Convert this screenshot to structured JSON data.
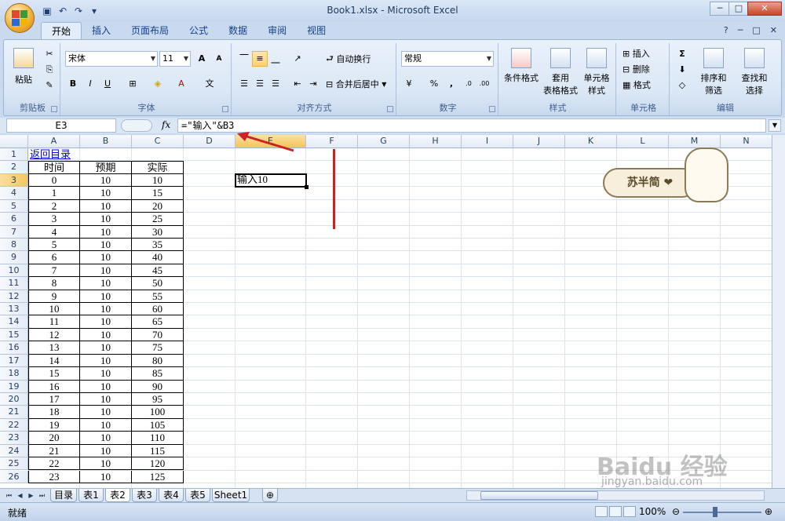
{
  "window": {
    "title": "Book1.xlsx - Microsoft Excel",
    "min": "─",
    "max": "□",
    "close": "✕"
  },
  "qat": {
    "save_icon": "save-icon",
    "undo_icon": "undo-icon",
    "redo_icon": "redo-icon"
  },
  "tabs": [
    "开始",
    "插入",
    "页面布局",
    "公式",
    "数据",
    "审阅",
    "视图"
  ],
  "ribbon": {
    "clipboard": {
      "label": "剪贴板",
      "paste": "粘贴"
    },
    "font": {
      "label": "字体",
      "font_name": "宋体",
      "font_size": "11"
    },
    "alignment": {
      "label": "对齐方式",
      "wrap": "自动换行",
      "merge": "合并后居中"
    },
    "number": {
      "label": "数字",
      "format": "常规",
      "percent": "%",
      "comma": ","
    },
    "styles": {
      "label": "样式",
      "conditional": "条件格式",
      "table_1": "套用",
      "table_2": "表格格式",
      "cell_1": "单元格",
      "cell_2": "样式"
    },
    "cells": {
      "label": "单元格",
      "insert": "插入",
      "delete": "删除",
      "format": "格式"
    },
    "editing": {
      "label": "编辑",
      "sort_1": "排序和",
      "sort_2": "筛选",
      "find_1": "查找和",
      "find_2": "选择"
    }
  },
  "formula_bar": {
    "name_box": "E3",
    "fx": "fx",
    "formula": "=\"输入\"&B3"
  },
  "columns": [
    "A",
    "B",
    "C",
    "D",
    "E",
    "F",
    "G",
    "H",
    "I",
    "J",
    "K",
    "L",
    "M",
    "N"
  ],
  "sheet": {
    "a1": "返回目录",
    "headers": [
      "时间",
      "预期",
      "实际"
    ],
    "rows": [
      [
        "0",
        "10",
        "10"
      ],
      [
        "1",
        "10",
        "15"
      ],
      [
        "2",
        "10",
        "20"
      ],
      [
        "3",
        "10",
        "25"
      ],
      [
        "4",
        "10",
        "30"
      ],
      [
        "5",
        "10",
        "35"
      ],
      [
        "6",
        "10",
        "40"
      ],
      [
        "7",
        "10",
        "45"
      ],
      [
        "8",
        "10",
        "50"
      ],
      [
        "9",
        "10",
        "55"
      ],
      [
        "10",
        "10",
        "60"
      ],
      [
        "11",
        "10",
        "65"
      ],
      [
        "12",
        "10",
        "70"
      ],
      [
        "13",
        "10",
        "75"
      ],
      [
        "14",
        "10",
        "80"
      ],
      [
        "15",
        "10",
        "85"
      ],
      [
        "16",
        "10",
        "90"
      ],
      [
        "17",
        "10",
        "95"
      ],
      [
        "18",
        "10",
        "100"
      ],
      [
        "19",
        "10",
        "105"
      ],
      [
        "20",
        "10",
        "110"
      ],
      [
        "21",
        "10",
        "115"
      ],
      [
        "22",
        "10",
        "120"
      ],
      [
        "23",
        "10",
        "125"
      ]
    ],
    "e3": "输入10"
  },
  "sticker": {
    "text": "苏半简 ❤"
  },
  "sheet_tabs": [
    "目录",
    "表1",
    "表2",
    "表3",
    "表4",
    "表5",
    "Sheet1"
  ],
  "status": {
    "ready": "就绪",
    "zoom": "100%"
  },
  "watermark": {
    "main": "Baidu 经验",
    "sub": "jingyan.baidu.com"
  },
  "colors": {
    "accent": "#15428b",
    "link": "#0000ee",
    "annotation": "#cc2222"
  }
}
